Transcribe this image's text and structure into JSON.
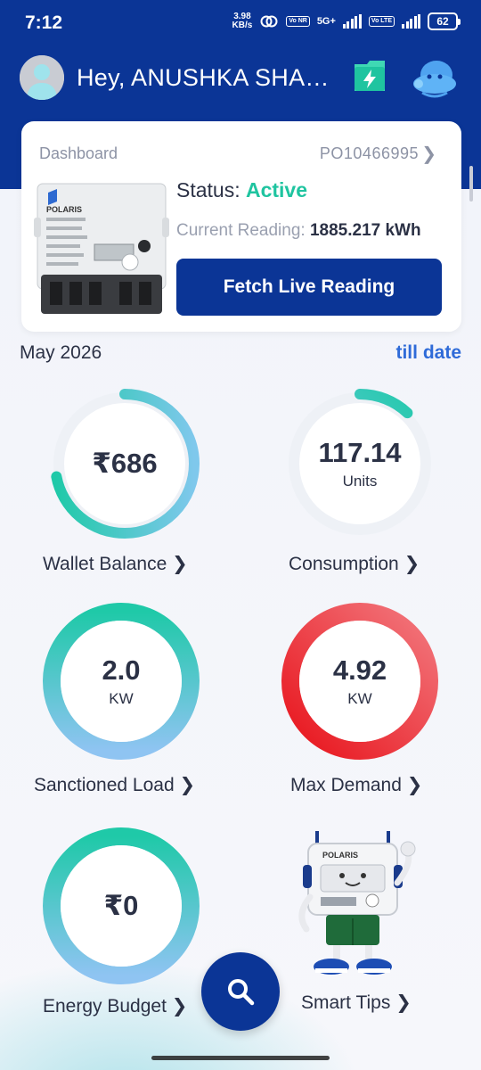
{
  "status_bar": {
    "time": "7:12",
    "speed_value": "3.98",
    "speed_unit": "KB/s",
    "vo_nr": "Vo NR",
    "network": "5G+",
    "vo_lte": "Vo LTE",
    "battery": "62"
  },
  "header": {
    "greeting": "Hey, ANUSHKA SHA…",
    "wallet_icon": "wallet-lightning-icon",
    "assistant_icon": "ai-assistant-icon",
    "avatar_icon": "user-avatar-icon"
  },
  "dashboard": {
    "title": "Dashboard",
    "meter_id": "PO10466995",
    "status_label": "Status: ",
    "status_value": "Active",
    "reading_label": "Current Reading: ",
    "reading_value": "1885.217 kWh",
    "fetch_button": "Fetch Live Reading",
    "meter_brand": "POLARIS"
  },
  "period": {
    "month": "May 2026",
    "range": "till date"
  },
  "tiles": [
    {
      "value": "₹686",
      "unit": "",
      "label": "Wallet Balance",
      "progress": 0.72
    },
    {
      "value": "117.14",
      "unit": "Units",
      "label": "Consumption",
      "progress": 0.12
    },
    {
      "value": "2.0",
      "unit": "KW",
      "label": "Sanctioned Load",
      "progress": 1.0
    },
    {
      "value": "4.92",
      "unit": "KW",
      "label": "Max Demand",
      "progress": 1.0
    },
    {
      "value": "₹0",
      "unit": "",
      "label": "Energy Budget",
      "progress": 1.0
    },
    {
      "value": "",
      "unit": "",
      "label": "Smart Tips",
      "progress": 0
    }
  ],
  "colors": {
    "brand_blue": "#0b3596",
    "active_green": "#1fc4a0",
    "link_blue": "#2f6bd8",
    "gauge_teal": "#1fc9a8",
    "gauge_light_blue": "#7fc8ec",
    "gauge_red": "#e8141c"
  },
  "fab": {
    "icon": "search-icon"
  }
}
